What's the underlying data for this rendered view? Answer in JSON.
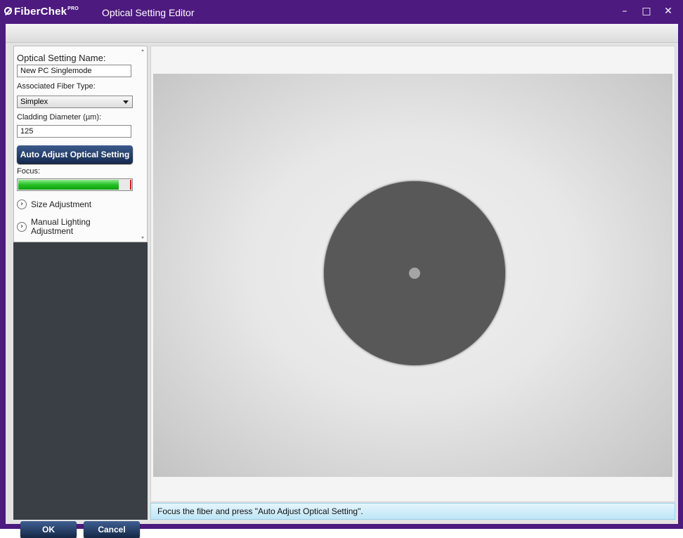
{
  "titlebar": {
    "brand": "FiberChek",
    "brand_suffix": "PRO",
    "title": "Optical Setting Editor",
    "minimize": "–",
    "maximize": "□",
    "close": "✕"
  },
  "sidebar": {
    "name_label": "Optical Setting Name:",
    "name_value": "New PC Singlemode",
    "fiber_type_label": "Associated Fiber Type:",
    "fiber_type_value": "Simplex",
    "cladding_label": "Cladding Diameter (µm):",
    "cladding_value": "125",
    "auto_adjust_button": "Auto Adjust Optical Setting",
    "focus_label": "Focus:",
    "focus_level": 0.88,
    "size_adjustment": "Size Adjustment",
    "manual_lighting_line1": "Manual Lighting",
    "manual_lighting_line2": "Adjustment"
  },
  "buttons": {
    "ok": "OK",
    "cancel": "Cancel"
  },
  "status": {
    "message": "Focus the fiber and press \"Auto Adjust Optical Setting\"."
  },
  "colors": {
    "titlebar": "#4d1a7f",
    "focus_green": "#25c025",
    "button_blue": "#1f3a66"
  }
}
